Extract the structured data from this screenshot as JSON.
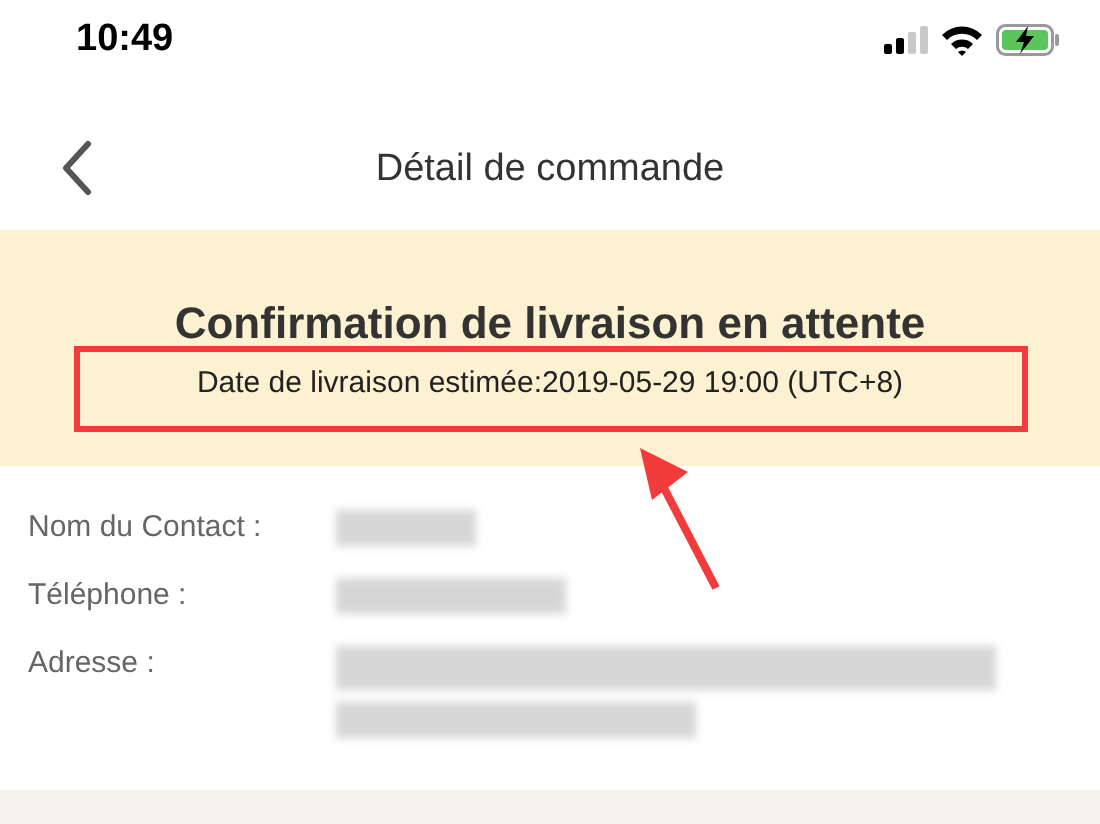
{
  "status_bar": {
    "time": "10:49",
    "battery_charging": true
  },
  "nav_bar": {
    "title": "Détail de commande"
  },
  "banner": {
    "title": "Confirmation de livraison en attente",
    "subtitle": "Date de livraison estimée:2019-05-29 19:00 (UTC+8)",
    "highlighted": true
  },
  "details": [
    {
      "label": "Nom du Contact :",
      "kind": "name"
    },
    {
      "label": "Téléphone :",
      "kind": "phone"
    },
    {
      "label": "Adresse :",
      "kind": "address"
    }
  ]
}
